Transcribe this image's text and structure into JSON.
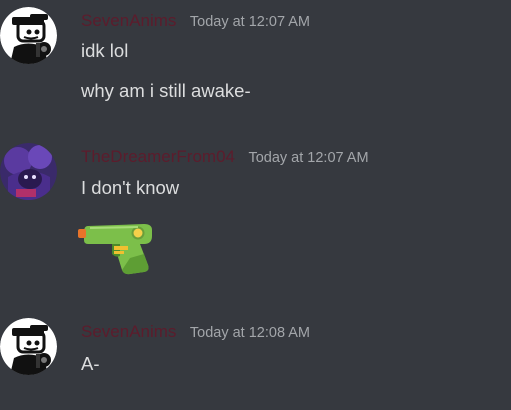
{
  "messages": [
    {
      "author": "SevenAnims",
      "author_color": "#5c1c2c",
      "timestamp": "Today at 12:07 AM",
      "lines": [
        "idk lol",
        "why am i still awake-"
      ]
    },
    {
      "author": "TheDreamerFrom04",
      "author_color": "#5c1c2c",
      "timestamp": "Today at 12:07 AM",
      "lines": [
        "I don't know"
      ],
      "attachment_icon": "water-pistol-emoji"
    },
    {
      "author": "SevenAnims",
      "author_color": "#5c1c2c",
      "timestamp": "Today at 12:08 AM",
      "lines": [
        "A-"
      ]
    }
  ],
  "colors": {
    "background": "#36393f",
    "text": "#dcddde",
    "timestamp": "#a3a6aa"
  }
}
